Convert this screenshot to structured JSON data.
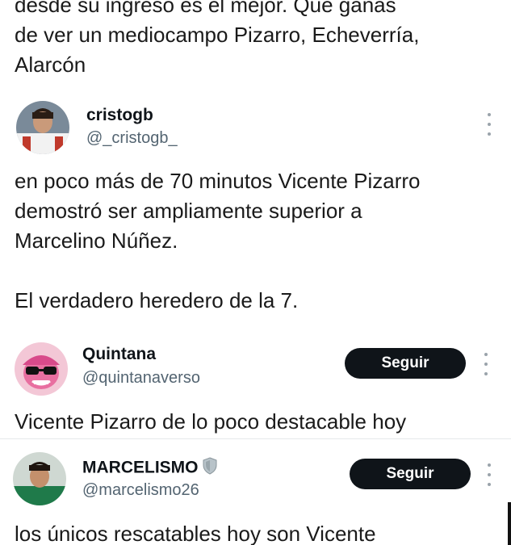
{
  "tweets": [
    {
      "text": "desde su ingreso es el mejor. Que ganas\nde ver un mediocampo Pizarro, Echeverría,\nAlarcón"
    },
    {
      "name": "cristogb",
      "handle": "@_cristogb_",
      "text": "en poco más de 70 minutos Vicente Pizarro\ndemostró ser ampliamente superior a\nMarcelino Núñez.\n\nEl verdadero heredero de la 7."
    },
    {
      "name": "Quintana",
      "handle": "@quintanaverso",
      "follow_label": "Seguir",
      "text": "Vicente Pizarro de lo poco destacable hoy"
    },
    {
      "name": "MARCELISMO",
      "handle": "@marcelismo26",
      "follow_label": "Seguir",
      "text": "los únicos rescatables hoy son Vicente"
    }
  ],
  "colors": {
    "text": "#0f1419",
    "secondary": "#536471",
    "button_bg": "#0f1419",
    "button_text": "#ffffff"
  },
  "icons": {
    "more": "more-vertical-icon",
    "verified": "shield-icon"
  }
}
